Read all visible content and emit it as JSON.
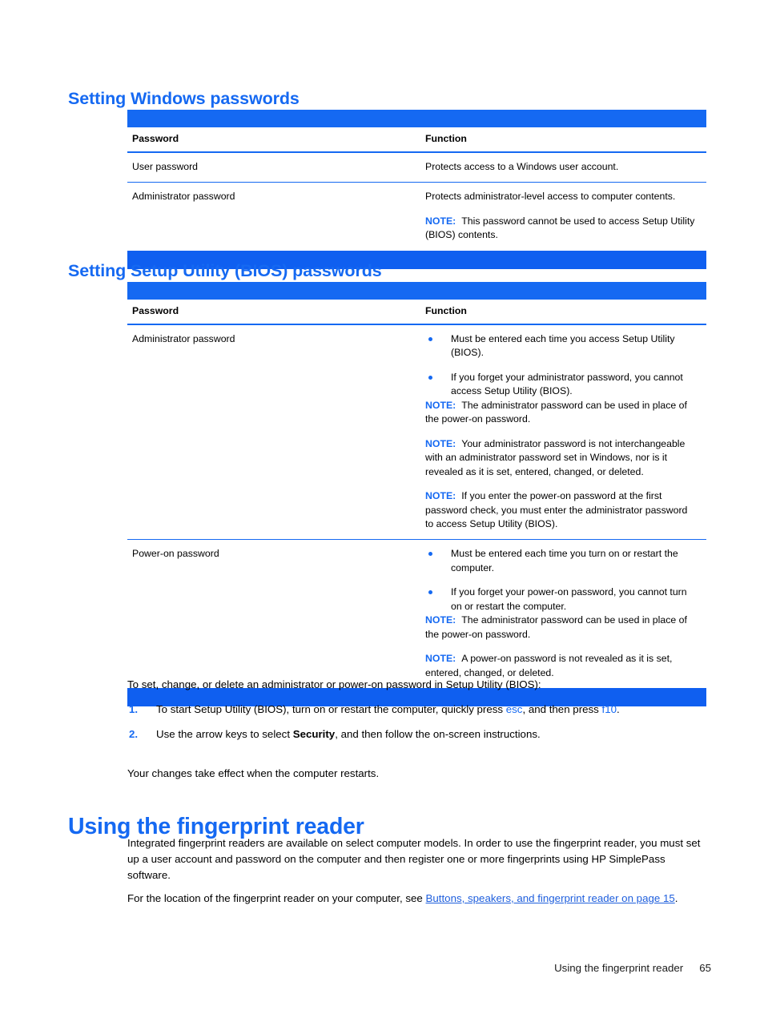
{
  "document": {
    "accent_color": "#1569f2",
    "rule_color": "#0f5ff0",
    "link_color": "#1f5fdd"
  },
  "section_windows": {
    "heading": "Setting Windows passwords",
    "table": {
      "headers": [
        "Password",
        "Function"
      ],
      "rows": [
        {
          "password": "User password",
          "function_paragraphs": [
            {
              "type": "text",
              "text": "Protects access to a Windows user account."
            }
          ]
        },
        {
          "password": "Administrator password",
          "function_paragraphs": [
            {
              "type": "text",
              "text": "Protects administrator-level access to computer contents."
            },
            {
              "type": "note",
              "label": "NOTE:",
              "text": "This password cannot be used to access Setup Utility (BIOS) contents."
            }
          ]
        }
      ]
    }
  },
  "section_bios": {
    "heading": "Setting Setup Utility (BIOS) passwords",
    "table": {
      "headers": [
        "Password",
        "Function"
      ],
      "rows": [
        {
          "password": "Administrator password",
          "bullets": [
            "Must be entered each time you access Setup Utility (BIOS).",
            "If you forget your administrator password, you cannot access Setup Utility (BIOS)."
          ],
          "notes": [
            {
              "label": "NOTE:",
              "text": "The administrator password can be used in place of the power-on password."
            },
            {
              "label": "NOTE:",
              "text": "Your administrator password is not interchangeable with an administrator password set in Windows, nor is it revealed as it is set, entered, changed, or deleted."
            },
            {
              "label": "NOTE:",
              "text": "If you enter the power-on password at the first password check, you must enter the administrator password to access Setup Utility (BIOS)."
            }
          ]
        },
        {
          "password": "Power-on password",
          "bullets": [
            "Must be entered each time you turn on or restart the computer.",
            "If you forget your power-on password, you cannot turn on or restart the computer."
          ],
          "notes": [
            {
              "label": "NOTE:",
              "text": "The administrator password can be used in place of the power-on password."
            },
            {
              "label": "NOTE:",
              "text": "A power-on password is not revealed as it is set, entered, changed, or deleted."
            }
          ]
        }
      ]
    }
  },
  "procedure": {
    "intro": "To set, change, or delete an administrator or power-on password in Setup Utility (BIOS):",
    "steps": [
      {
        "number": "1.",
        "parts": [
          {
            "type": "text",
            "text": "To start Setup Utility (BIOS), turn on or restart the computer, quickly press "
          },
          {
            "type": "key",
            "text": "esc"
          },
          {
            "type": "text",
            "text": ", and then press "
          },
          {
            "type": "key",
            "text": "f10"
          },
          {
            "type": "text",
            "text": "."
          }
        ]
      },
      {
        "number": "2.",
        "parts": [
          {
            "type": "text",
            "text": "Use the arrow keys to select "
          },
          {
            "type": "bold",
            "text": "Security"
          },
          {
            "type": "text",
            "text": ", and then follow the on-screen instructions."
          }
        ]
      }
    ],
    "outro": "Your changes take effect when the computer restarts."
  },
  "section_fingerprint": {
    "heading": "Using the fingerprint reader",
    "paragraph1": "Integrated fingerprint readers are available on select computer models. In order to use the fingerprint reader, you must set up a user account and password on the computer and then register one or more fingerprints using HP SimplePass software.",
    "paragraph2_prefix": "For the location of the fingerprint reader on your computer, see ",
    "paragraph2_link": "Buttons, speakers, and fingerprint reader on page 15",
    "paragraph2_suffix": "."
  },
  "footer": {
    "section_title": "Using the fingerprint reader",
    "page_number": "65"
  }
}
